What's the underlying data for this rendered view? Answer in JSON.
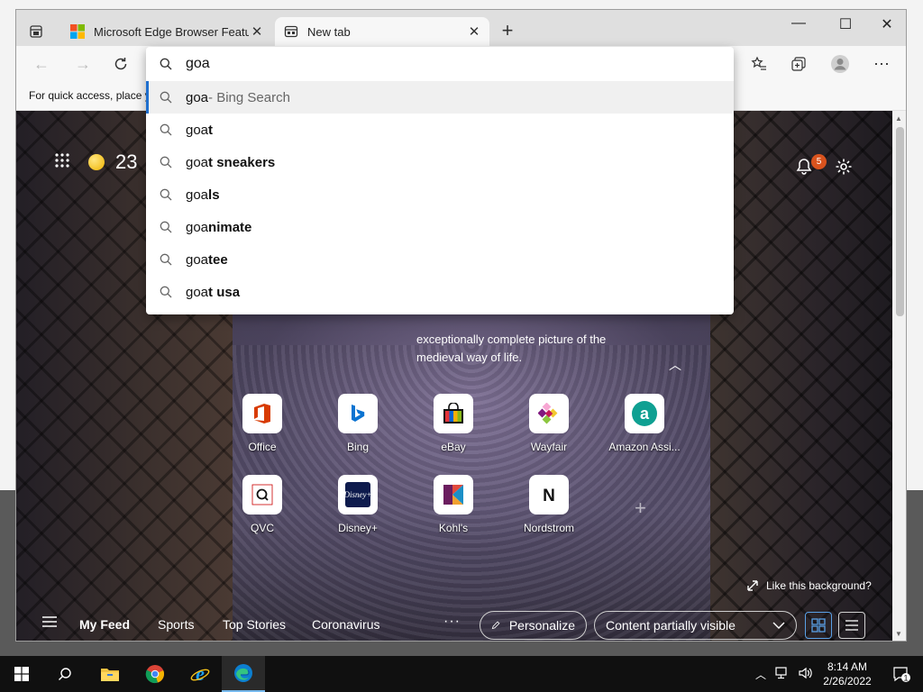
{
  "browser": {
    "tabs": [
      {
        "title": "Microsoft Edge Browser Features"
      },
      {
        "title": "New tab"
      }
    ],
    "favorites_bar_hint": "For quick access, place y",
    "address_value": "goa"
  },
  "suggestions": [
    {
      "typed": "goa",
      "rest": "",
      "suffix": " - Bing Search"
    },
    {
      "typed": "goa",
      "rest": "t",
      "suffix": ""
    },
    {
      "typed": "goa",
      "rest": "t sneakers",
      "suffix": ""
    },
    {
      "typed": "goa",
      "rest": "ls",
      "suffix": ""
    },
    {
      "typed": "goa",
      "rest": "nimate",
      "suffix": ""
    },
    {
      "typed": "goa",
      "rest": "tee",
      "suffix": ""
    },
    {
      "typed": "goa",
      "rest": "t usa",
      "suffix": ""
    }
  ],
  "ntp": {
    "points": "23",
    "notifications_count": "5",
    "caption_line1": "exceptionally complete picture of the",
    "caption_line2": "medieval way of life.",
    "like_background": "Like this background?",
    "quick_links": [
      {
        "label": "Office",
        "icon": "office-icon"
      },
      {
        "label": "Bing",
        "icon": "bing-icon"
      },
      {
        "label": "eBay",
        "icon": "ebay-icon"
      },
      {
        "label": "Wayfair",
        "icon": "wayfair-icon"
      },
      {
        "label": "Amazon Assi...",
        "icon": "amazon-icon"
      },
      {
        "label": "QVC",
        "icon": "qvc-icon"
      },
      {
        "label": "Disney+",
        "icon": "disney-icon"
      },
      {
        "label": "Kohl's",
        "icon": "kohls-icon"
      },
      {
        "label": "Nordstrom",
        "icon": "nordstrom-icon"
      }
    ],
    "feed_tabs": [
      "My Feed",
      "Sports",
      "Top Stories",
      "Coronavirus"
    ],
    "personalize": "Personalize",
    "content_visibility": "Content partially visible"
  },
  "taskbar": {
    "time": "8:14 AM",
    "date": "2/26/2022",
    "notification_count": "1"
  },
  "colors": {
    "accent": "#1f6fce",
    "badge": "#d9531e"
  }
}
